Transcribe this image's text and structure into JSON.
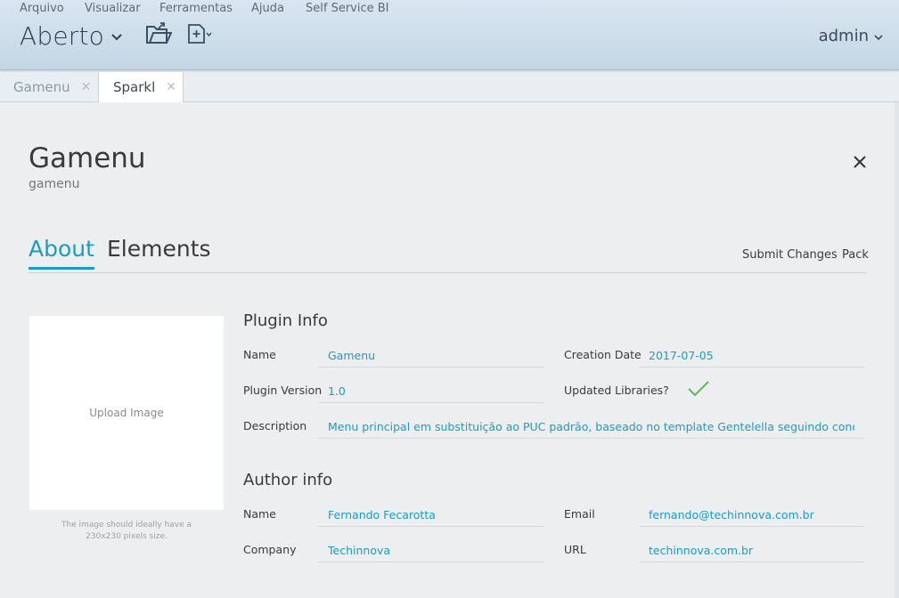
{
  "menu": [
    "Arquivo",
    "Visualizar",
    "Ferramentas",
    "Ajuda",
    "Self Service BI"
  ],
  "perspective": {
    "title": "Aberto"
  },
  "toolbar": {
    "icons": [
      "open-folder-icon",
      "new-file-icon"
    ]
  },
  "user": {
    "name": "admin"
  },
  "tabs": [
    {
      "label": "Gamenu",
      "active": false
    },
    {
      "label": "Sparkl",
      "active": true
    }
  ],
  "plugin": {
    "title": "Gamenu",
    "id": "gamenu"
  },
  "subtabs": [
    "About",
    "Elements"
  ],
  "actions": {
    "submit": "Submit Changes",
    "pack": "Pack"
  },
  "upload": {
    "label": "Upload Image",
    "hint": "The image should ideally have a 230x230 pixels size."
  },
  "plugin_info": {
    "title": "Plugin Info",
    "name_label": "Name",
    "name": "Gamenu",
    "creation_date_label": "Creation Date",
    "creation_date": "2017-07-05",
    "version_label": "Plugin Version",
    "version": "1.0",
    "updated_libraries_label": "Updated Libraries?",
    "updated_libraries": true,
    "description_label": "Description",
    "description": "Menu principal em substituição ao PUC padrão, baseado no template Gentelella seguindo conceitos"
  },
  "author_info": {
    "title": "Author info",
    "name_label": "Name",
    "name": "Fernando Fecarotta",
    "email_label": "Email",
    "email": "fernando@techinnova.com.br",
    "company_label": "Company",
    "company": "Techinnova",
    "url_label": "URL",
    "url": "techinnova.com.br"
  },
  "colors": {
    "accent": "#1c9bc3",
    "header_top": "#d9e6f0",
    "header_bottom": "#c4d6e4",
    "check": "#5cb85c"
  }
}
